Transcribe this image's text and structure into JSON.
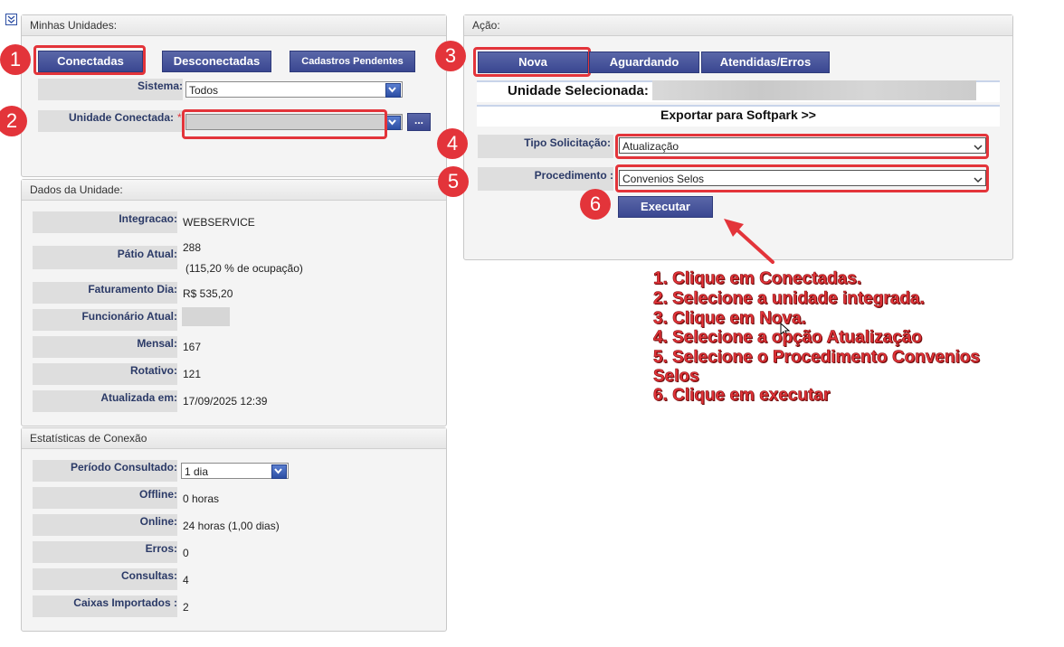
{
  "left_panel": {
    "title": "Minhas Unidades:",
    "buttons": {
      "connected": "Conectadas",
      "disconnected": "Desconectadas",
      "pending": "Cadastros Pendentes"
    },
    "sistema_label": "Sistema:",
    "sistema_value": "Todos",
    "unidade_label": "Unidade Conectada:",
    "required_mark": "*",
    "ellipsis_button": "..."
  },
  "dados": {
    "title": "Dados da Unidade:",
    "rows": [
      {
        "label": "Integracao:",
        "value": "WEBSERVICE"
      },
      {
        "label": "Pátio Atual:",
        "value": "288",
        "value2": "(115,20 % de ocupação)"
      },
      {
        "label": "Faturamento Dia:",
        "value": "R$ 535,20"
      },
      {
        "label": "Funcionário Atual:",
        "value": ""
      },
      {
        "label": "Mensal:",
        "value": "167"
      },
      {
        "label": "Rotativo:",
        "value": "121"
      },
      {
        "label": "Atualizada em:",
        "value": "17/09/2025 12:39"
      }
    ]
  },
  "stats": {
    "title": "Estatísticas de Conexão",
    "periodo_label": "Período Consultado:",
    "periodo_value": "1 dia",
    "rows": [
      {
        "label": "Offline:",
        "value": "0 horas"
      },
      {
        "label": "Online:",
        "value": "24 horas (1,00 dias)"
      },
      {
        "label": "Erros:",
        "value": "0"
      },
      {
        "label": "Consultas:",
        "value": "4"
      },
      {
        "label": "Caixas Importados :",
        "value": "2"
      }
    ]
  },
  "acao": {
    "title": "Ação:",
    "tabs": {
      "nova": "Nova",
      "aguardando": "Aguardando",
      "atendidas": "Atendidas/Erros"
    },
    "unidade_selecionada": "Unidade Selecionada:",
    "exportar": "Exportar para Softpark >>",
    "tipo_label": "Tipo Solicitação:",
    "tipo_value": "Atualização",
    "procedimento_label": "Procedimento :",
    "procedimento_value": "Convenios Selos",
    "executar": "Executar"
  },
  "badges": [
    "1",
    "2",
    "3",
    "4",
    "5",
    "6"
  ],
  "instructions": [
    "1. Clique em Conectadas.",
    "2. Selecione a unidade integrada.",
    "3. Clique em Nova.",
    "4. Selecione a opção Atualização",
    "5. Selecione o Procedimento Convenios",
    "Selos",
    "6. Clique em executar"
  ],
  "colors": {
    "accent_red": "#e3343a",
    "button_blue": "#3a4791",
    "label_blue": "#2b3a67"
  },
  "icons": {
    "collapse": "collapse-icon",
    "dropdown": "chevron-down-icon",
    "cursor": "mouse-cursor-icon"
  }
}
